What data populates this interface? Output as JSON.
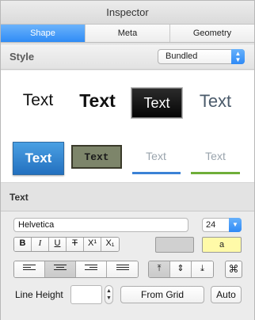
{
  "window": {
    "title": "Inspector"
  },
  "tabs": [
    {
      "label": "Shape",
      "active": true
    },
    {
      "label": "Meta",
      "active": false
    },
    {
      "label": "Geometry",
      "active": false
    }
  ],
  "style_section": {
    "label": "Style",
    "preset_select": {
      "value": "Bundled",
      "icon": "up-down-stepper-icon"
    }
  },
  "style_samples": [
    "Text",
    "Text",
    "Text",
    "Text",
    "Text",
    "Text",
    "Text",
    "Text"
  ],
  "text_section": {
    "label": "Text",
    "font_family": "Helvetica",
    "font_size": "24",
    "format_buttons": [
      "B",
      "I",
      "U",
      "T",
      "X¹",
      "X₁"
    ],
    "text_color_label": "a",
    "fill_color": "#d0d0d0",
    "text_highlight_color": "#fffaa8",
    "align_buttons": [
      "align-left-icon",
      "align-center-icon",
      "align-right-icon",
      "align-justify-icon"
    ],
    "valign_buttons": [
      "valign-top-icon",
      "valign-middle-icon",
      "valign-bottom-icon"
    ],
    "line_height_label": "Line Height",
    "line_height_value": "",
    "from_grid_label": "From Grid",
    "auto_label": "Auto"
  },
  "colors": {
    "accent": "#2f8cf6",
    "underline_blue": "#3b82d6",
    "underline_green": "#6fae39"
  }
}
